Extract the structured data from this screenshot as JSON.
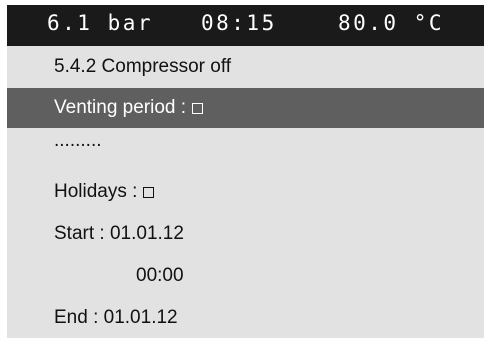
{
  "status": {
    "pressure": "6.1 bar",
    "time": "08:15",
    "temperature": "80.0 °C"
  },
  "menu": {
    "heading": "5.4.2 Compressor off",
    "venting_label": "Venting period :",
    "venting_checked": false,
    "ellipsis": ".........",
    "holidays_label": "Holidays :",
    "holidays_checked": false,
    "start": "Start : 01.01.12",
    "start_time": "00:00",
    "end": "End : 01.01.12"
  },
  "colors": {
    "status_bar_bg": "#1a1a1a",
    "screen_bg": "#e2e2e2",
    "selected_row_bg": "#5f5f5f"
  }
}
